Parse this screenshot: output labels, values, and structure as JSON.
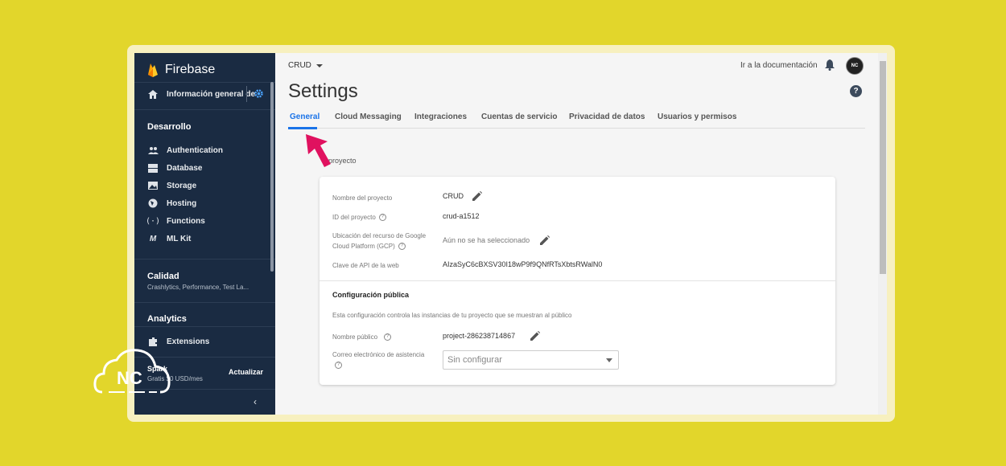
{
  "sidebar": {
    "brand": "Firebase",
    "overview_label": "Información general de",
    "sections": {
      "develop": {
        "heading": "Desarrollo",
        "items": [
          {
            "label": "Authentication",
            "icon": "people-icon"
          },
          {
            "label": "Database",
            "icon": "database-icon"
          },
          {
            "label": "Storage",
            "icon": "storage-icon"
          },
          {
            "label": "Hosting",
            "icon": "hosting-icon"
          },
          {
            "label": "Functions",
            "icon": "functions-icon"
          },
          {
            "label": "ML Kit",
            "icon": "ml-kit-icon"
          }
        ]
      },
      "quality": {
        "heading": "Calidad",
        "sub": "Crashlytics, Performance, Test La..."
      },
      "analytics": {
        "heading": "Analytics"
      },
      "extensions": {
        "label": "Extensions"
      }
    },
    "plan": {
      "name": "Spark",
      "price": "Gratis $0 USD/mes",
      "upgrade": "Actualizar"
    },
    "collapse_icon": "chevron-left-icon"
  },
  "topbar": {
    "project": "CRUD",
    "docs_link": "Ir a la documentación"
  },
  "page": {
    "title": "Settings",
    "tabs": [
      {
        "label": "General",
        "active": true
      },
      {
        "label": "Cloud Messaging",
        "active": false
      },
      {
        "label": "Integraciones",
        "active": false
      },
      {
        "label": "Cuentas de servicio",
        "active": false
      },
      {
        "label": "Privacidad de datos",
        "active": false
      },
      {
        "label": "Usuarios y permisos",
        "active": false
      }
    ],
    "section_label": "proyecto"
  },
  "card": {
    "rows": [
      {
        "label": "Nombre del proyecto",
        "value": "CRUD"
      },
      {
        "label": "ID del proyecto",
        "value": "crud-a1512"
      },
      {
        "label_line1": "Ubicación del recurso de Google",
        "label_line2": "Cloud Platform (GCP)",
        "value": "Aún no se ha seleccionado"
      },
      {
        "label": "Clave de API de la web",
        "value": "AIzaSyC6cBXSV30I18wP9f9QNfRTsXbtsRWalN0"
      }
    ],
    "public_config": {
      "title": "Configuración pública",
      "description": "Esta configuración controla las instancias de tu proyecto que se muestran al público",
      "public_name_label": "Nombre público",
      "public_name_value": "project-286238714867",
      "support_email_label": "Correo electrónico de asistencia",
      "support_email_placeholder": "Sin configurar"
    }
  },
  "overlay": {
    "logo_text": "NC"
  },
  "colors": {
    "accent": "#1a73e8",
    "sidebar": "#1a2b42",
    "arrow": "#e0115f",
    "background": "#e2d62b"
  }
}
